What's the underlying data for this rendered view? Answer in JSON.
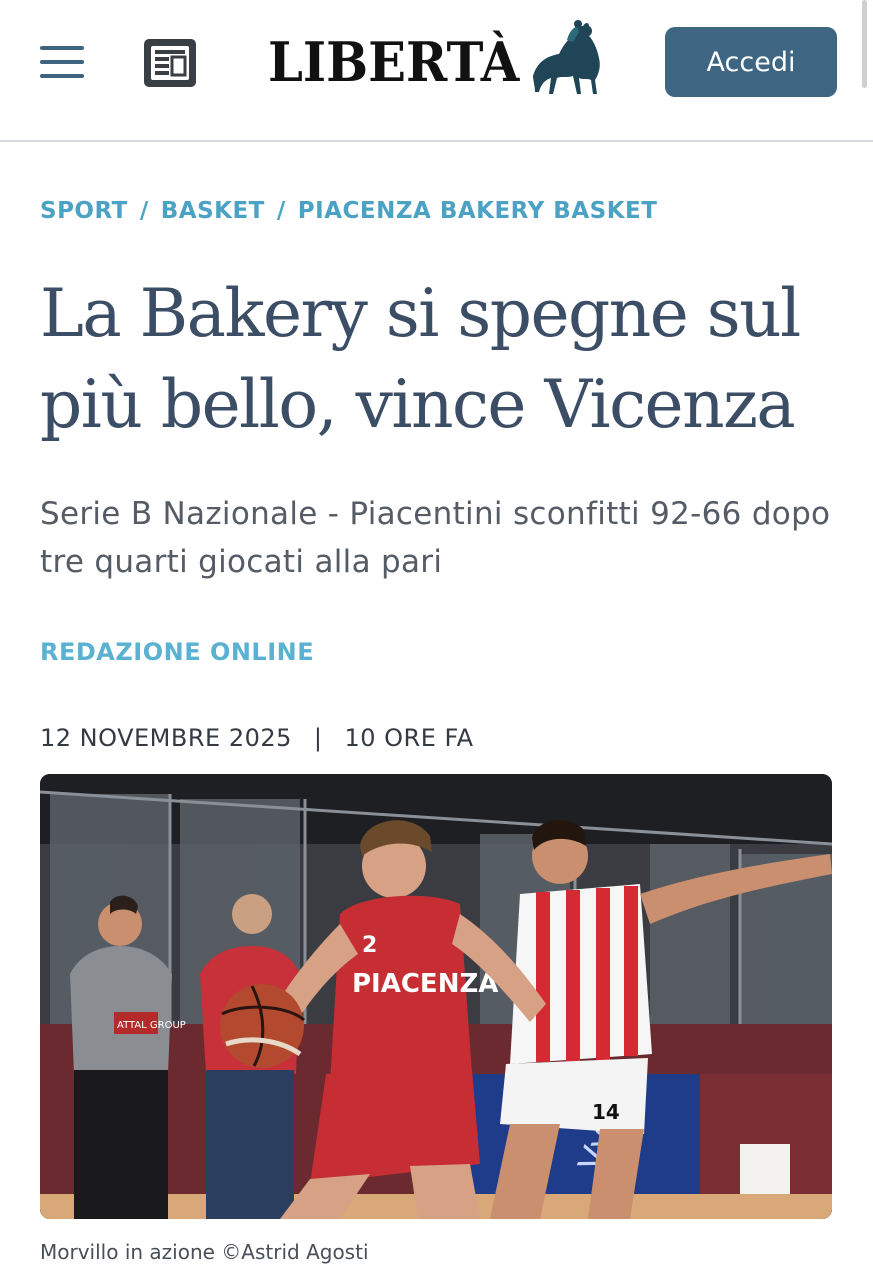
{
  "header": {
    "logo_text": "LIBERTÀ",
    "login_label": "Accedi"
  },
  "breadcrumb": [
    "SPORT",
    "BASKET",
    "PIACENZA BAKERY BASKET"
  ],
  "article": {
    "title": "La Bakery si spegne sul più bello, vince Vicenza",
    "subtitle": "Serie B Nazionale - Piacentini sconfitti 92-66 dopo tre quarti giocati alla pari",
    "author": "REDAZIONE ONLINE",
    "date": "12 NOVEMBRE 2025",
    "separator": "|",
    "relative_time": "10 ORE FA"
  },
  "photo": {
    "caption": "Morvillo in azione ©Astrid Agosti",
    "jersey_left_number": "2",
    "jersey_left_text": "PIACENZA",
    "jersey_right_number": "14",
    "referee_patch": "ATTAL GROUP"
  },
  "icons": {
    "menu": "hamburger-menu-icon",
    "edition": "newspaper-icon",
    "logo_mark": "horse-rider-logo-icon"
  },
  "colors": {
    "accent": "#3e6682",
    "breadcrumb": "#4ba2c5",
    "author": "#5bb1d1",
    "headline": "#3c4d66"
  }
}
